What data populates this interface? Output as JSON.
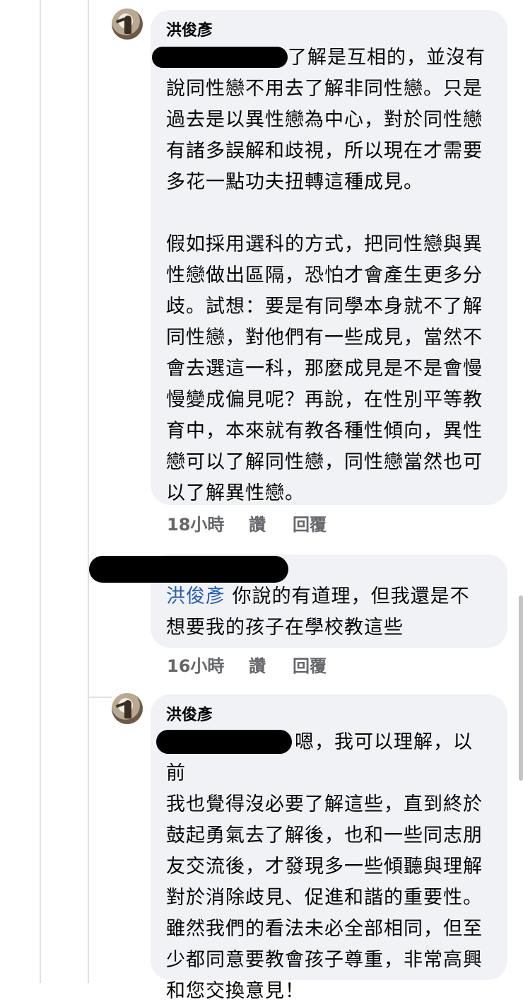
{
  "comments": [
    {
      "author": "洪俊彥",
      "lines_p1": [
        "了解是互相的，並沒有",
        "說同性戀不用去了解非同性戀。只是",
        "過去是以異性戀為中心，對於同性戀",
        "有諸多誤解和歧視，所以現在才需要",
        "多花一點功夫扭轉這種成見。"
      ],
      "lines_p2": [
        "假如採用選科的方式，把同性戀與異",
        "性戀做出區隔，恐怕才會產生更多分",
        "歧。試想：要是有同學本身就不了解",
        "同性戀，對他們有一些成見，當然不",
        "會去選這一科，那麼成見是不是會慢",
        "慢變成偏見呢？再說，在性別平等教",
        "育中，本來就有教各種性傾向，異性",
        "戀可以了解同性戀，同性戀當然也可",
        "以了解異性戀。"
      ],
      "time": "18小時",
      "like": "讚",
      "reply": "回覆"
    },
    {
      "mention": "洪俊彥",
      "line1": "你說的有道理，但我還是不",
      "line2": "想要我的孩子在學校教這些",
      "time": "16小時",
      "like": "讚",
      "reply": "回覆"
    },
    {
      "author": "洪俊彥",
      "lines": [
        "嗯，我可以理解，以前",
        "我也覺得沒必要了解這些，直到終於",
        "鼓起勇氣去了解後，也和一些同志朋",
        "友交流後，才發現多一些傾聽與理解",
        "對於消除歧見、促進和諧的重要性。",
        "雖然我們的看法未必全部相同，但至",
        "少都同意要教會孩子尊重，非常高興",
        "和您交換意見！"
      ]
    }
  ],
  "colors": {
    "bubble": "#f0f2f5",
    "mention": "#2a5db0",
    "meta": "#65676b"
  }
}
